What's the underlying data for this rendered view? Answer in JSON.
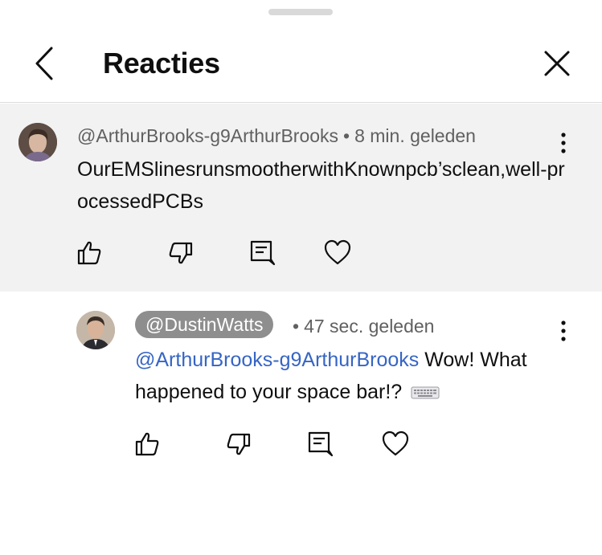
{
  "header": {
    "title": "Reacties"
  },
  "parent_comment": {
    "author": "@ArthurBrooks-g9ArthurBrooks",
    "separator": "•",
    "time": "8 min. geleden",
    "text": "OurEMSlinesrunsmootherwithKnownpcb’sclean,well-processedPCBs"
  },
  "reply": {
    "author": "@DustinWatts",
    "separator": "•",
    "time": "47 sec. geleden",
    "mention": "@ArthurBrooks-g9ArthurBrooks",
    "text": "Wow! What happened to your space bar!?",
    "emoji": "keyboard-emoji"
  },
  "icons": {
    "back": "chevron-left-icon",
    "close": "close-icon",
    "more": "more-vert-icon",
    "like": "thumbs-up-icon",
    "dislike": "thumbs-down-icon",
    "reply": "reply-comment-icon",
    "heart": "heart-icon"
  },
  "colors": {
    "mention": "#3665c5",
    "parent_background": "#f2f2f2",
    "badge_background": "#8e8e8e"
  }
}
